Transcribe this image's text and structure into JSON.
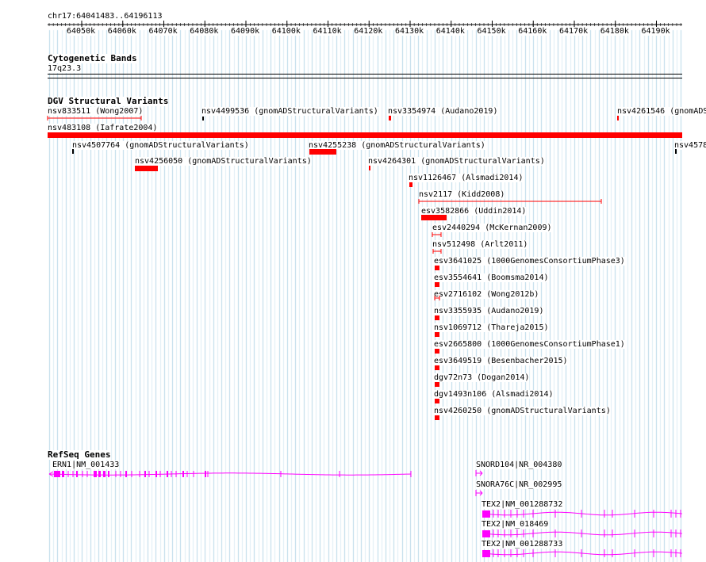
{
  "colors": {
    "variant": "#ff0000",
    "gene": "#ff00ff",
    "grid_major": "#b8d8e8",
    "grid_minor": "#dcecf4"
  },
  "ruler": {
    "location": "chr17:64041483..64196113",
    "ticks": [
      "64050k",
      "64060k",
      "64070k",
      "64080k",
      "64090k",
      "64100k",
      "64110k",
      "64120k",
      "64130k",
      "64140k",
      "64150k",
      "64160k",
      "64170k",
      "64180k",
      "64190k"
    ]
  },
  "cytoband": {
    "title": "Cytogenetic Bands",
    "band": "17q23.3"
  },
  "dgv": {
    "title": "DGV Structural Variants",
    "labels": [
      "nsv833511 (Wong2007)",
      "nsv4499536 (gnomADStructuralVariants)",
      "nsv3354974 (Audano2019)",
      "nsv4261546 (gnomADS",
      "nsv483108 (Iafrate2004)",
      "nsv4507764 (gnomADStructuralVariants)",
      "nsv4255238 (gnomADStructuralVariants)",
      "nsv4578",
      "nsv4256050 (gnomADStructuralVariants)",
      "nsv4264301 (gnomADStructuralVariants)",
      "nsv1126467 (Alsmadi2014)",
      "nsv2117 (Kidd2008)",
      "esv3582866 (Uddin2014)",
      "esv2440294 (McKernan2009)",
      "nsv512498 (Arlt2011)",
      "esv3641025 (1000GenomesConsortiumPhase3)",
      "esv3554641 (Boomsma2014)",
      "esv2716102 (Wong2012b)",
      "nsv3355935 (Audano2019)",
      "nsv1069712 (Thareja2015)",
      "esv2665800 (1000GenomesConsortiumPhase1)",
      "esv3649519 (Besenbacher2015)",
      "dgv72n73 (Dogan2014)",
      "dgv1493n106 (Alsmadi2014)",
      "nsv4260250 (gnomADStructuralVariants)"
    ]
  },
  "refseq": {
    "title": "RefSeq Genes",
    "labels": [
      "ERN1|NM_001433",
      "SNORD104|NR_004380",
      "SNORA76C|NR_002995",
      "TEX2|NM_001288732",
      "TEX2|NM_018469",
      "TEX2|NM_001288733"
    ]
  }
}
